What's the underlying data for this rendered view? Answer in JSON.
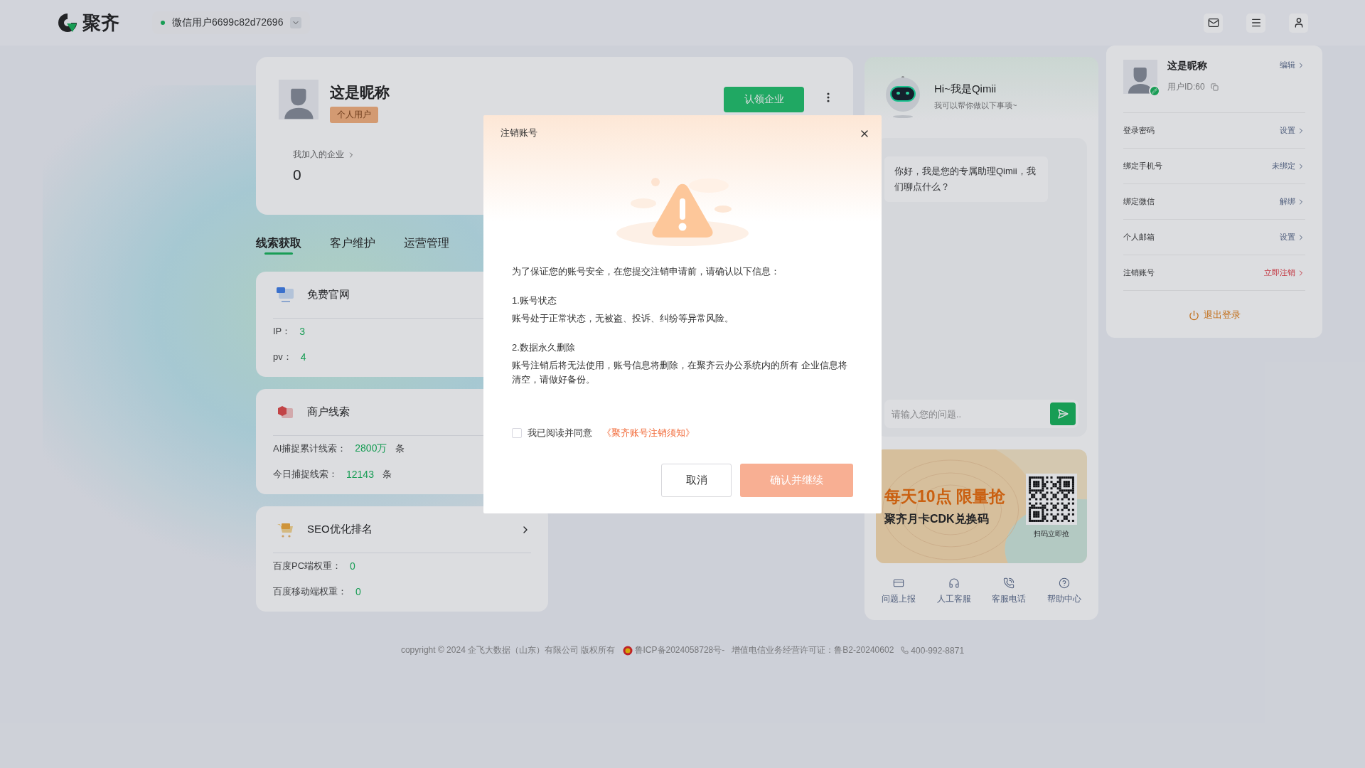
{
  "header": {
    "logo": "聚齐",
    "account": {
      "name": "微信用户6699c82d72696",
      "online": true
    }
  },
  "profile": {
    "nickname": "这是昵称",
    "badge": "个人用户",
    "claim_button": "认领企业",
    "joined_label": "我加入的企业",
    "joined_count": "0"
  },
  "tabs": [
    {
      "label": "线索获取",
      "selected": true
    },
    {
      "label": "客户维护",
      "selected": false
    },
    {
      "label": "运营管理",
      "selected": false
    }
  ],
  "cards": [
    {
      "kind": "monitor",
      "title": "免费官网",
      "arrow": false,
      "stats": [
        {
          "label": "IP：",
          "value": "3"
        },
        {
          "label": "pv：",
          "value": "4"
        }
      ]
    },
    {
      "kind": "shop",
      "title": "商户线索",
      "arrow": false,
      "stats": [
        {
          "label": "AI捕捉累计线索：",
          "value": "2800万",
          "unit": "条"
        },
        {
          "label": "今日捕捉线索：",
          "value": "12143",
          "unit": "条"
        }
      ]
    },
    {
      "kind": "cart",
      "title": "SEO优化排名",
      "arrow": true,
      "stats": [
        {
          "label": "百度PC端权重：",
          "value": "0"
        },
        {
          "label": "百度移动端权重：",
          "value": "0"
        }
      ]
    }
  ],
  "assistant": {
    "title": "Hi~我是Qimii",
    "subtitle": "我可以帮你做以下事项~",
    "message": "你好，我是您的专属助理Qimii，我们聊点什么？",
    "placeholder": "请输入您的问题..",
    "promo": {
      "headline": "每天10点 限量抢",
      "subline": "聚齐月卡CDK兑换码",
      "qr_caption": "扫码立即抢"
    },
    "shortcuts": [
      {
        "kind": "report",
        "label": "问题上报"
      },
      {
        "kind": "headset",
        "label": "人工客服"
      },
      {
        "kind": "phone",
        "label": "客服电话"
      },
      {
        "kind": "help",
        "label": "帮助中心"
      }
    ]
  },
  "user_menu": {
    "nickname": "这是昵称",
    "user_id": "用户ID:60",
    "edit": "编辑",
    "rows": [
      {
        "label": "登录密码",
        "action": "设置",
        "kind": "normal"
      },
      {
        "label": "绑定手机号",
        "action": "未绑定",
        "kind": "normal"
      },
      {
        "label": "绑定微信",
        "action": "解绑",
        "kind": "normal"
      },
      {
        "label": "个人邮箱",
        "action": "设置",
        "kind": "normal"
      },
      {
        "label": "注销账号",
        "action": "立即注销",
        "kind": "danger"
      }
    ],
    "logout": "退出登录"
  },
  "dialog": {
    "title": "注销账号",
    "intro": "为了保证您的账号安全，在您提交注销申请前，请确认以下信息：",
    "sections": [
      {
        "heading": "1.账号状态",
        "body": "账号处于正常状态，无被盗、投诉、纠纷等异常风险。"
      },
      {
        "heading": "2.数据永久删除",
        "body": "账号注销后将无法使用，账号信息将删除，在聚齐云办公系统内的所有 企业信息将清空，请做好备份。"
      }
    ],
    "agree": {
      "label": "我已阅读并同意",
      "link": "《聚齐账号注销须知》",
      "checked": false
    },
    "cancel": "取消",
    "confirm": "确认并继续",
    "confirm_disabled": true
  },
  "footer": {
    "copyright": "copyright © 2024 企飞大数据（山东）有限公司 版权所有",
    "icp": "鲁ICP备2024058728号-",
    "license": "增值电信业务经营许可证：鲁B2-20240602",
    "phone": "400-992-8871"
  }
}
